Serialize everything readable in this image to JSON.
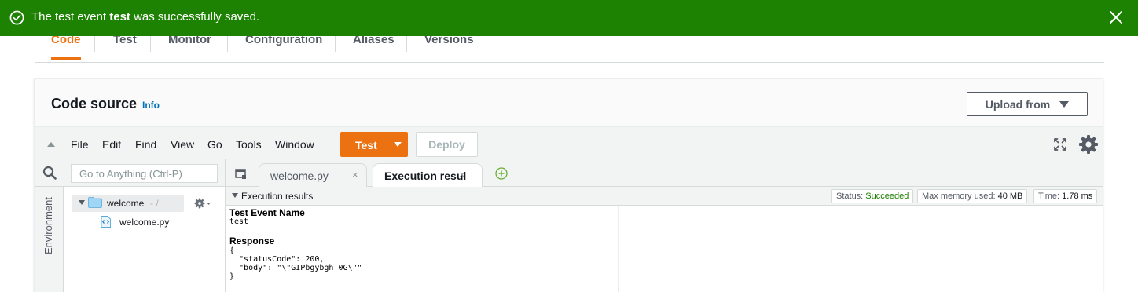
{
  "tabs": [
    {
      "label": "Code",
      "active": true
    },
    {
      "label": "Test"
    },
    {
      "label": "Monitor"
    },
    {
      "label": "Configuration"
    },
    {
      "label": "Aliases"
    },
    {
      "label": "Versions"
    }
  ],
  "banner": {
    "prefix": "The test event ",
    "event_name": "test",
    "suffix": " was successfully saved.",
    "color": "#1d8102",
    "icons": {
      "status": "check-circle-icon",
      "close": "close-icon"
    }
  },
  "code_source": {
    "title": "Code source",
    "info": "Info",
    "upload": "Upload from"
  },
  "menu": {
    "items": [
      "File",
      "Edit",
      "Find",
      "View",
      "Go",
      "Tools",
      "Window"
    ],
    "test": "Test",
    "deploy": "Deploy",
    "accent": "#ec7211"
  },
  "search": {
    "placeholder": "Go to Anything (Ctrl-P)"
  },
  "environment": {
    "label": "Environment",
    "root": "welcome",
    "root_path": "- /",
    "file": "welcome.py"
  },
  "editor": {
    "tabs": [
      {
        "label": "welcome.py",
        "active": false
      },
      {
        "label": "Execution results",
        "active": true
      }
    ],
    "close_glyph": "×"
  },
  "results": {
    "title": "Execution results",
    "status_label": "Status: ",
    "status_value": "Succeeded",
    "memory_label": "Max memory used: ",
    "memory_value": "40 MB",
    "time_label": "Time: ",
    "time_value": "1.78 ms",
    "event_name_label": "Test Event Name",
    "event_name_value": "test",
    "response_label": "Response",
    "response_body": "{\n  \"statusCode\": 200,\n  \"body\": \"\\\"GIPbgybgh_0G\\\"\"\n}"
  }
}
